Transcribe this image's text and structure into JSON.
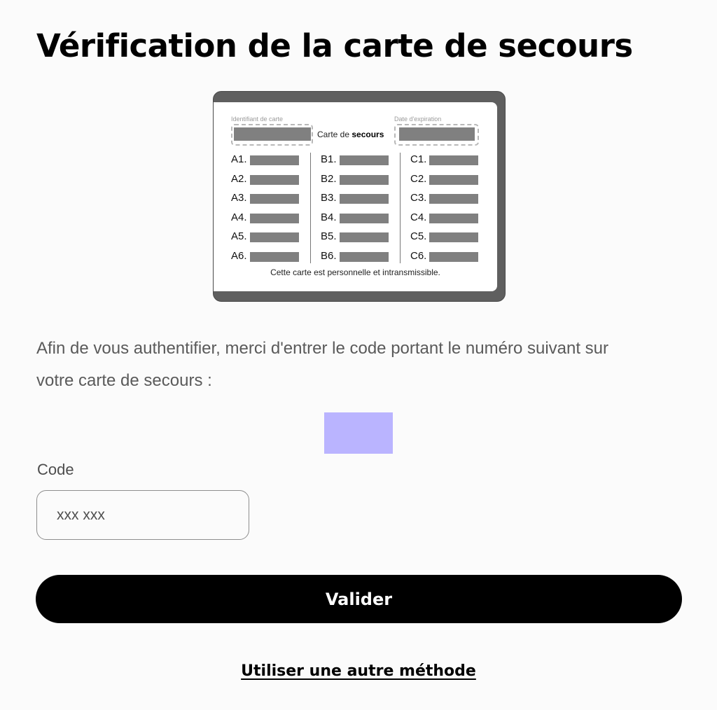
{
  "page": {
    "title": "Vérification de la carte de secours"
  },
  "card": {
    "id_label": "Identifiant de carte",
    "expiry_label": "Date d'expiration",
    "heading_prefix": "Carte de ",
    "heading_bold": "secours",
    "columns": [
      [
        "A1.",
        "A2.",
        "A3.",
        "A4.",
        "A5.",
        "A6."
      ],
      [
        "B1.",
        "B2.",
        "B3.",
        "B4.",
        "B5.",
        "B6."
      ],
      [
        "C1.",
        "C2.",
        "C3.",
        "C4.",
        "C5.",
        "C6."
      ]
    ],
    "footer": "Cette carte est personnelle et intransmissible.",
    "frame_color": "#5f5f5f",
    "redaction_color": "#808080"
  },
  "instructions": "Afin de vous authentifier, merci d'entrer le code portant le numéro suivant sur votre carte de secours :",
  "code_highlight_color": "#bab4ff",
  "form": {
    "code_label": "Code",
    "code_placeholder": "xxx xxx",
    "code_value": "",
    "submit_label": "Valider"
  },
  "alt_method_link": "Utiliser une autre méthode"
}
